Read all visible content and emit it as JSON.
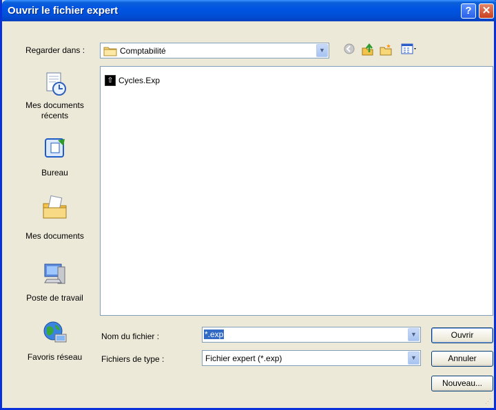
{
  "dialog": {
    "title": "Ouvrir le fichier expert",
    "help_icon": "question-mark-icon",
    "close_icon": "close-icon"
  },
  "lookin": {
    "label": "Regarder dans :",
    "value": "Comptabilité",
    "toolbar_icons": [
      "back-icon",
      "up-folder-icon",
      "new-folder-icon",
      "view-menu-icon"
    ]
  },
  "places": [
    {
      "label": "Mes documents récents",
      "icon": "recent-documents-icon"
    },
    {
      "label": "Bureau",
      "icon": "desktop-icon"
    },
    {
      "label": "Mes documents",
      "icon": "my-documents-icon"
    },
    {
      "label": "Poste de travail",
      "icon": "my-computer-icon"
    },
    {
      "label": "Favoris réseau",
      "icon": "network-places-icon"
    }
  ],
  "files": [
    {
      "name": "Cycles.Exp",
      "icon": "expert-file-icon"
    }
  ],
  "filename": {
    "label": "Nom du fichier :",
    "value": "*.exp"
  },
  "filetype": {
    "label": "Fichiers de type :",
    "value": "Fichier expert (*.exp)"
  },
  "buttons": {
    "open": "Ouvrir",
    "cancel": "Annuler",
    "new": "Nouveau..."
  }
}
